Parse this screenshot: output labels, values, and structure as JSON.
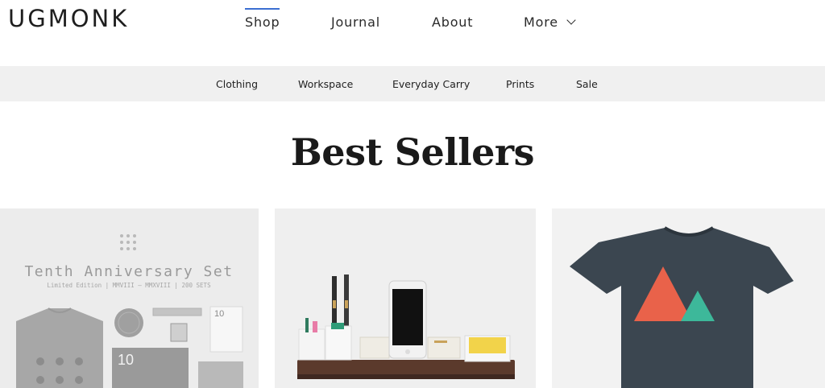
{
  "header": {
    "logo": "UGMONK",
    "nav": [
      {
        "label": "Shop",
        "active": true
      },
      {
        "label": "Journal"
      },
      {
        "label": "About"
      },
      {
        "label": "More"
      }
    ]
  },
  "sub_nav": [
    "Clothing",
    "Workspace",
    "Everyday Carry",
    "Prints",
    "Sale"
  ],
  "section_title": "Best Sellers",
  "products": [
    {
      "title": "Tenth Anniversary Set",
      "subtitle": "Limited Edition | MMVIII – MMXVIII | 200 SETS",
      "badge_number": "10"
    },
    {
      "icon": "desk-organizer-image"
    },
    {
      "icon": "triangle-tshirt-image"
    }
  ],
  "colors": {
    "accent": "#3b6fd1",
    "subnav_bg": "#f0f0f0",
    "card_bg": "#ececec",
    "tee_dark": "#3a4650",
    "tri_orange": "#e9624a",
    "tri_green": "#3db89a"
  }
}
